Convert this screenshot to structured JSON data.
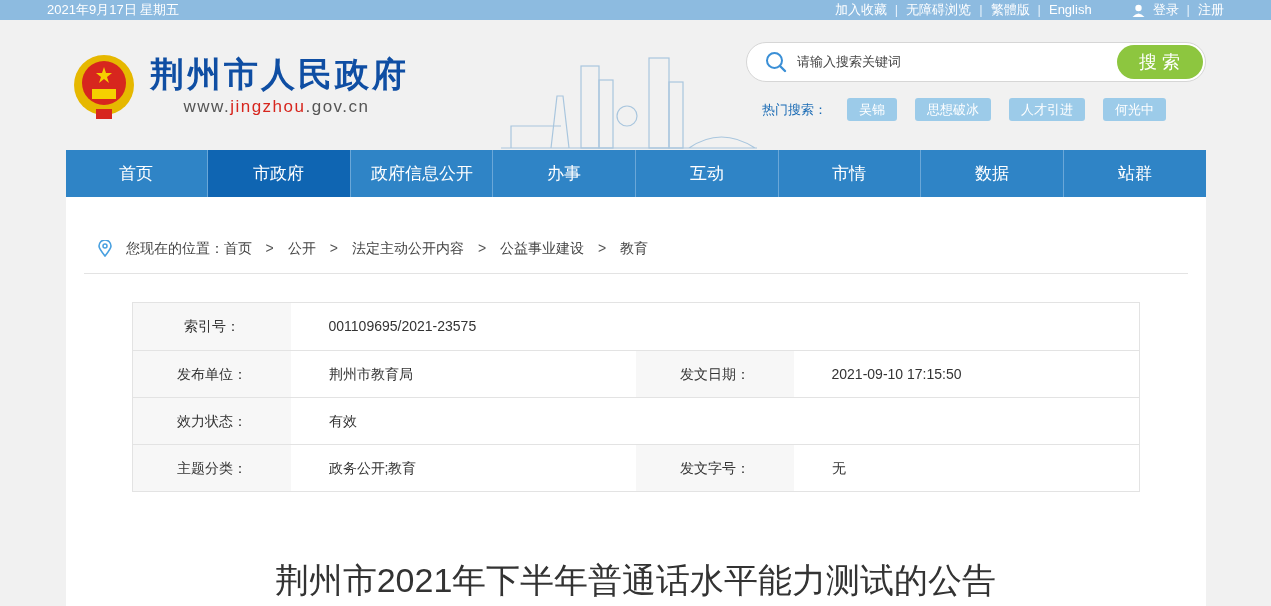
{
  "top_bar": {
    "date": "2021年9月17日 星期五",
    "links": [
      {
        "kind": "link",
        "text": "加入收藏"
      },
      {
        "kind": "separator",
        "text": "|"
      },
      {
        "kind": "link",
        "text": "无障碍浏览"
      },
      {
        "kind": "separator",
        "text": "|"
      },
      {
        "kind": "link",
        "text": "繁體版"
      },
      {
        "kind": "separator",
        "text": "|"
      },
      {
        "kind": "link",
        "text": "English"
      }
    ],
    "user_links": [
      {
        "kind": "link",
        "text": "登录"
      },
      {
        "kind": "separator",
        "text": "|"
      },
      {
        "kind": "link",
        "text": "注册"
      }
    ]
  },
  "header": {
    "site_name": "荆州市人民政府",
    "url": {
      "prefix": "www.",
      "domain": "jingzhou",
      "suffix": ".gov.cn"
    },
    "search": {
      "placeholder": "请输入搜索关键词",
      "button": "搜 索"
    },
    "hot_searches": {
      "label": "热门搜索：",
      "items": [
        "吴锦",
        "思想破冰",
        "人才引进",
        "何光中"
      ]
    }
  },
  "nav": [
    {
      "label": "首页",
      "selected": false
    },
    {
      "label": "市政府",
      "selected": true
    },
    {
      "label": "政府信息公开",
      "selected": false
    },
    {
      "label": "办事",
      "selected": false
    },
    {
      "label": "互动",
      "selected": false
    },
    {
      "label": "市情",
      "selected": false
    },
    {
      "label": "数据",
      "selected": false
    },
    {
      "label": "站群",
      "selected": false
    }
  ],
  "breadcrumb": {
    "label": "您现在的位置：",
    "items": [
      {
        "kind": "link",
        "text": "首页"
      },
      {
        "kind": "separator",
        "text": ">"
      },
      {
        "kind": "link",
        "text": "公开"
      },
      {
        "kind": "separator",
        "text": ">"
      },
      {
        "kind": "link",
        "text": "法定主动公开内容"
      },
      {
        "kind": "separator",
        "text": ">"
      },
      {
        "kind": "link",
        "text": "公益事业建设"
      },
      {
        "kind": "separator",
        "text": ">"
      },
      {
        "kind": "link",
        "text": "教育"
      }
    ]
  },
  "meta_table": [
    [
      {
        "label": "索引号：",
        "value": "001109695/2021-23575"
      }
    ],
    [
      {
        "label": "发布单位：",
        "value": "荆州市教育局"
      },
      {
        "label": "发文日期：",
        "value": "2021-09-10 17:15:50"
      }
    ],
    [
      {
        "label": "效力状态：",
        "value": "有效"
      }
    ],
    [
      {
        "label": "主题分类：",
        "value": "政务公开;教育"
      },
      {
        "label": "发文字号：",
        "value": "无"
      }
    ]
  ],
  "article_title": "荆州市2021年下半年普通话水平能力测试的公告"
}
